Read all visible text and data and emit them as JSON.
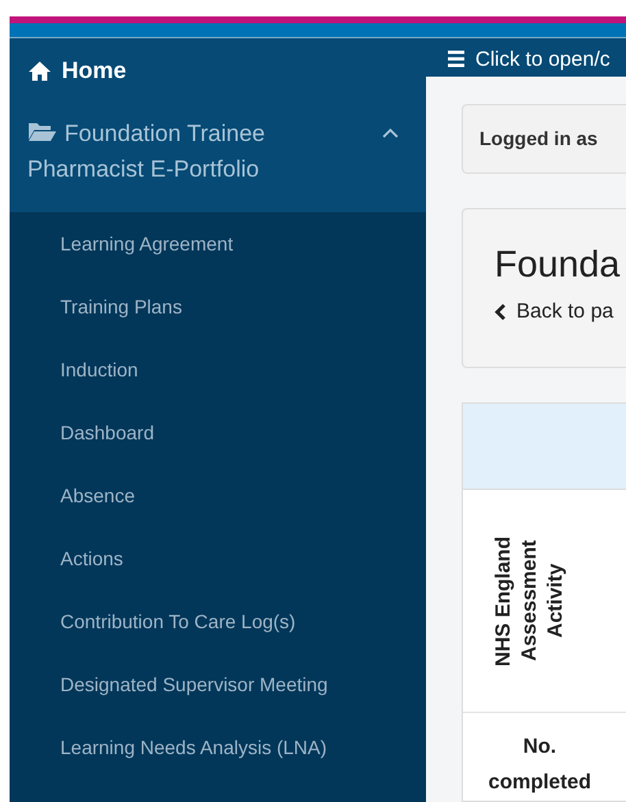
{
  "sidebar": {
    "home": {
      "label": "Home"
    },
    "section": {
      "label": "Foundation Trainee Pharmacist E-Portfolio",
      "expanded": true,
      "items": [
        {
          "label": "Learning Agreement"
        },
        {
          "label": "Training Plans"
        },
        {
          "label": "Induction"
        },
        {
          "label": "Dashboard"
        },
        {
          "label": "Absence"
        },
        {
          "label": "Actions"
        },
        {
          "label": "Contribution To Care Log(s)"
        },
        {
          "label": "Designated Supervisor Meeting"
        },
        {
          "label": "Learning Needs Analysis (LNA)"
        }
      ]
    }
  },
  "top_bar": {
    "toggle_label": "Click to open/c"
  },
  "main": {
    "logged_in": "Logged in as",
    "title": "Founda",
    "back_link": "Back to pa",
    "table": {
      "columns": [
        "NHS England Assessment Activity"
      ],
      "rows": [
        {
          "cells": [
            "No. completed"
          ]
        }
      ]
    }
  }
}
